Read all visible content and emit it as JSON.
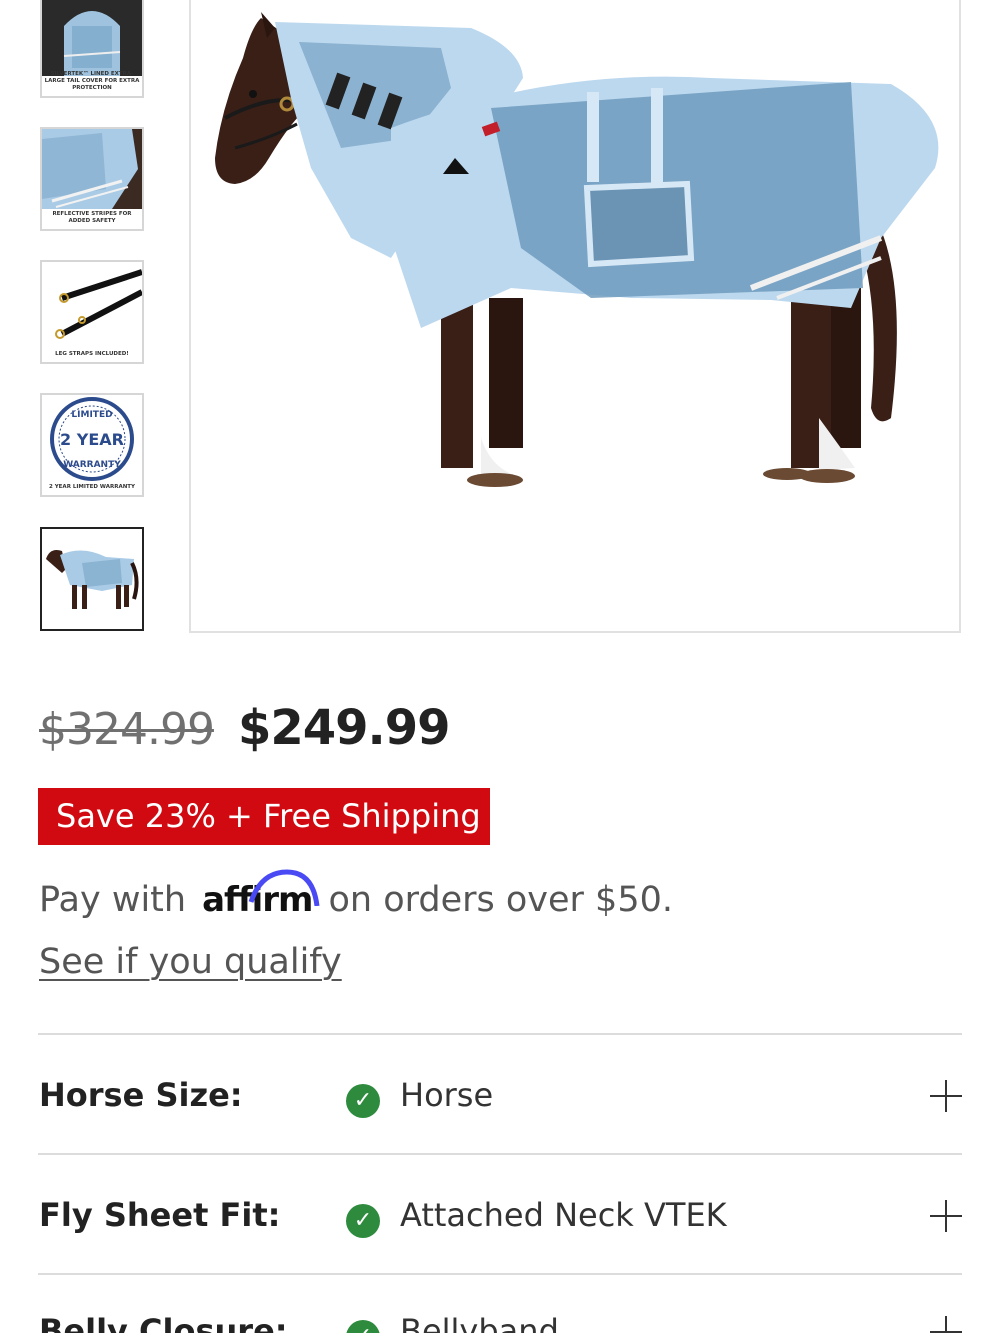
{
  "thumbnails": [
    {
      "caption": "SILVERTEK™ LINED EXTRA-LARGE TAIL COVER FOR EXTRA PROTECTION",
      "icon": "tail-cover-photo"
    },
    {
      "caption": "REFLECTIVE STRIPES FOR ADDED SAFETY",
      "icon": "reflective-stripes-photo"
    },
    {
      "caption": "LEG STRAPS INCLUDED!",
      "icon": "leg-straps-photo"
    },
    {
      "caption": "2 YEAR LIMITED WARRANTY",
      "icon": "warranty-seal",
      "seal": {
        "top": "LIMITED",
        "middle": "2 YEAR",
        "bottom": "WARRANTY"
      }
    },
    {
      "caption": "",
      "icon": "horse-fly-sheet-photo",
      "selected": true
    }
  ],
  "main_image": {
    "icon": "horse-fly-sheet-photo"
  },
  "pricing": {
    "old_price": "$324.99",
    "new_price": "$249.99",
    "badge": "Save 23% + Free Shipping"
  },
  "affirm": {
    "prefix": "Pay with",
    "logo": "affirm",
    "suffix": "on orders over $50.",
    "link": "See if you qualify"
  },
  "options": [
    {
      "label": "Horse Size:",
      "value": "Horse"
    },
    {
      "label": "Fly Sheet Fit:",
      "value": "Attached Neck VTEK"
    },
    {
      "label": "Belly Closure:",
      "value": "Bellyband"
    }
  ],
  "colors": {
    "badge": "#d10a11",
    "check": "#2e8b3e",
    "sheet": "#a9cbe6",
    "horse": "#3a1f17"
  }
}
